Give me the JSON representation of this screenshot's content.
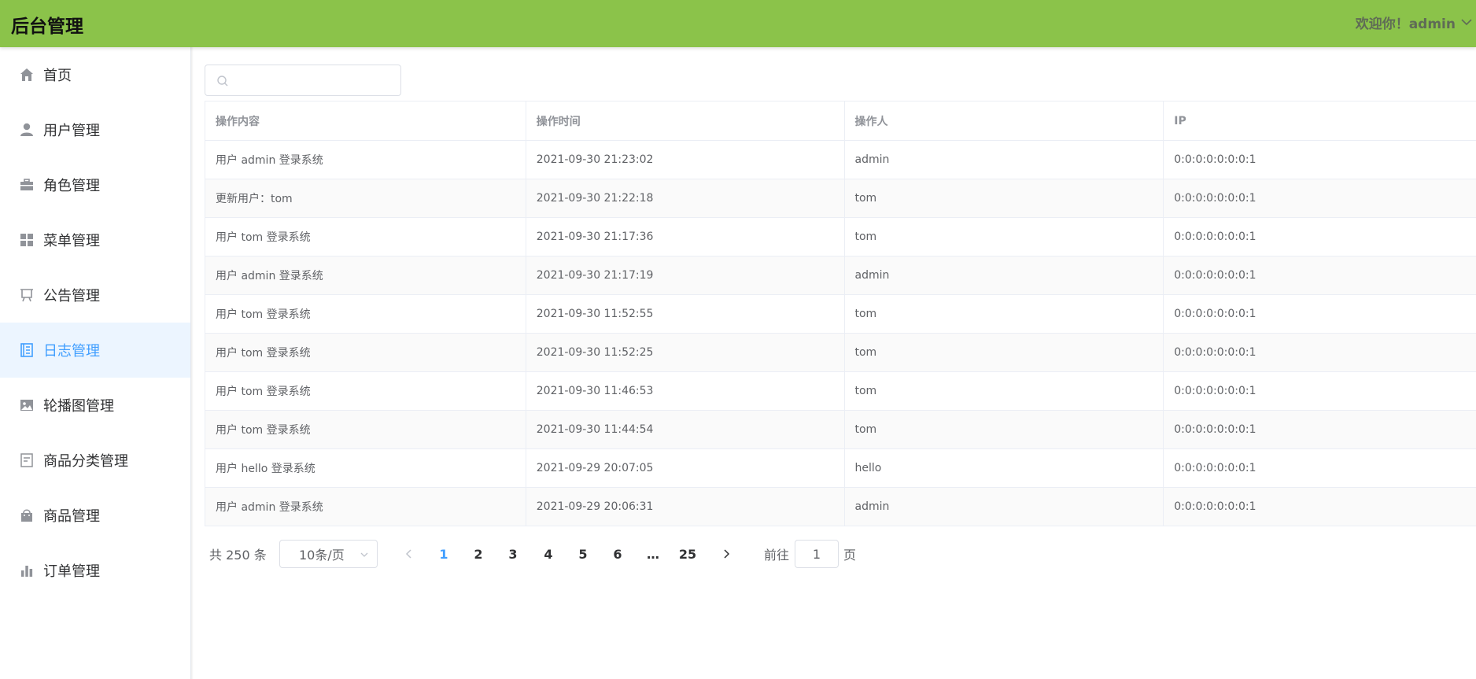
{
  "header": {
    "title": "后台管理",
    "welcome": "欢迎你！admin",
    "brand_color": "#8bc34a"
  },
  "sidebar": {
    "items": [
      {
        "label": "首页",
        "icon": "home-icon"
      },
      {
        "label": "用户管理",
        "icon": "user-icon"
      },
      {
        "label": "角色管理",
        "icon": "briefcase-icon"
      },
      {
        "label": "菜单管理",
        "icon": "menu-grid-icon"
      },
      {
        "label": "公告管理",
        "icon": "notice-board-icon"
      },
      {
        "label": "日志管理",
        "icon": "log-document-icon",
        "active": true
      },
      {
        "label": "轮播图管理",
        "icon": "picture-icon"
      },
      {
        "label": "商品分类管理",
        "icon": "tickets-icon"
      },
      {
        "label": "商品管理",
        "icon": "shopping-bag-icon"
      },
      {
        "label": "订单管理",
        "icon": "bar-chart-icon"
      }
    ],
    "active_color": "#409eff"
  },
  "search": {
    "placeholder": "",
    "value": "",
    "icon": "search-icon"
  },
  "table": {
    "columns": [
      "操作内容",
      "操作时间",
      "操作人",
      "IP"
    ],
    "rows": [
      [
        "用户 admin 登录系统",
        "2021-09-30 21:23:02",
        "admin",
        "0:0:0:0:0:0:0:1"
      ],
      [
        "更新用户：tom",
        "2021-09-30 21:22:18",
        "tom",
        "0:0:0:0:0:0:0:1"
      ],
      [
        "用户 tom 登录系统",
        "2021-09-30 21:17:36",
        "tom",
        "0:0:0:0:0:0:0:1"
      ],
      [
        "用户 admin 登录系统",
        "2021-09-30 21:17:19",
        "admin",
        "0:0:0:0:0:0:0:1"
      ],
      [
        "用户 tom 登录系统",
        "2021-09-30 11:52:55",
        "tom",
        "0:0:0:0:0:0:0:1"
      ],
      [
        "用户 tom 登录系统",
        "2021-09-30 11:52:25",
        "tom",
        "0:0:0:0:0:0:0:1"
      ],
      [
        "用户 tom 登录系统",
        "2021-09-30 11:46:53",
        "tom",
        "0:0:0:0:0:0:0:1"
      ],
      [
        "用户 tom 登录系统",
        "2021-09-30 11:44:54",
        "tom",
        "0:0:0:0:0:0:0:1"
      ],
      [
        "用户 hello 登录系统",
        "2021-09-29 20:07:05",
        "hello",
        "0:0:0:0:0:0:0:1"
      ],
      [
        "用户 admin 登录系统",
        "2021-09-29 20:06:31",
        "admin",
        "0:0:0:0:0:0:0:1"
      ]
    ]
  },
  "pagination": {
    "total": "共 250 条",
    "page_size": "10条/页",
    "pages": [
      "1",
      "2",
      "3",
      "4",
      "5",
      "6",
      "…",
      "25"
    ],
    "current": "1",
    "goto_label": "前往",
    "goto_value": "1",
    "page_suffix": "页"
  }
}
